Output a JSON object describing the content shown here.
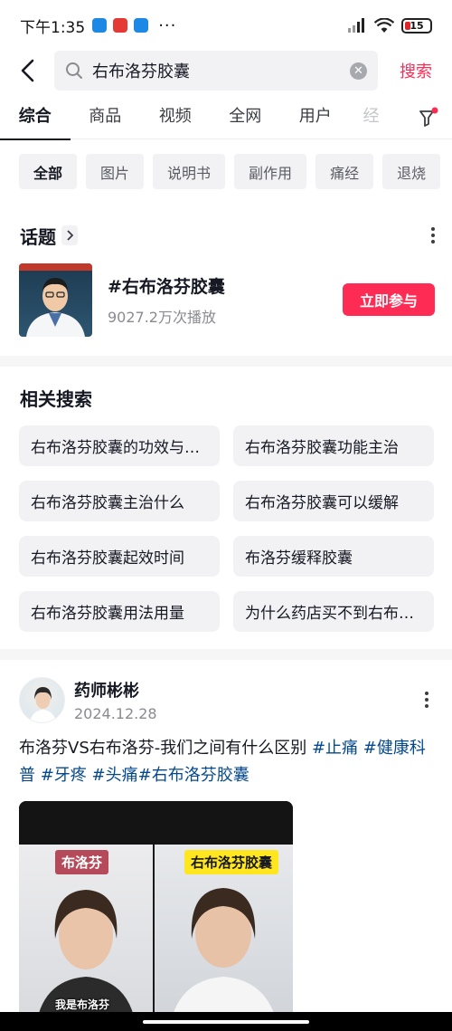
{
  "status": {
    "time": "下午1:35",
    "battery": "15"
  },
  "search": {
    "query": "右布洛芬胶囊",
    "button": "搜索"
  },
  "tabs": [
    {
      "label": "综合",
      "active": true
    },
    {
      "label": "商品"
    },
    {
      "label": "视频"
    },
    {
      "label": "全网"
    },
    {
      "label": "用户"
    },
    {
      "label": "经"
    }
  ],
  "chips": [
    "全部",
    "图片",
    "说明书",
    "副作用",
    "痛经",
    "退烧"
  ],
  "topic": {
    "heading": "话题",
    "title": "#右布洛芬胶囊",
    "plays": "9027.2万次播放",
    "join": "立即参与"
  },
  "related": {
    "heading": "相关搜索",
    "items": [
      "右布洛芬胶囊的功效与作用",
      "右布洛芬胶囊功能主治",
      "右布洛芬胶囊主治什么",
      "右布洛芬胶囊可以缓解",
      "右布洛芬胶囊起效时间",
      "布洛芬缓释胶囊",
      "右布洛芬胶囊用法用量",
      "为什么药店买不到右布洛芬"
    ]
  },
  "post": {
    "author": "药师彬彬",
    "date": "2024.12.28",
    "text": "布洛芬VS右布洛芬-我们之间有什么区别 ",
    "tags": [
      "#止痛",
      " #健康科普",
      " #牙疼",
      " #头痛",
      "#右布洛芬胶囊"
    ],
    "video": {
      "label_left": "布洛芬",
      "label_right": "右布洛芬胶囊",
      "caption": "我是布洛芬"
    }
  },
  "colors": {
    "accent": "#fe2c55",
    "tag": "#04498d"
  }
}
